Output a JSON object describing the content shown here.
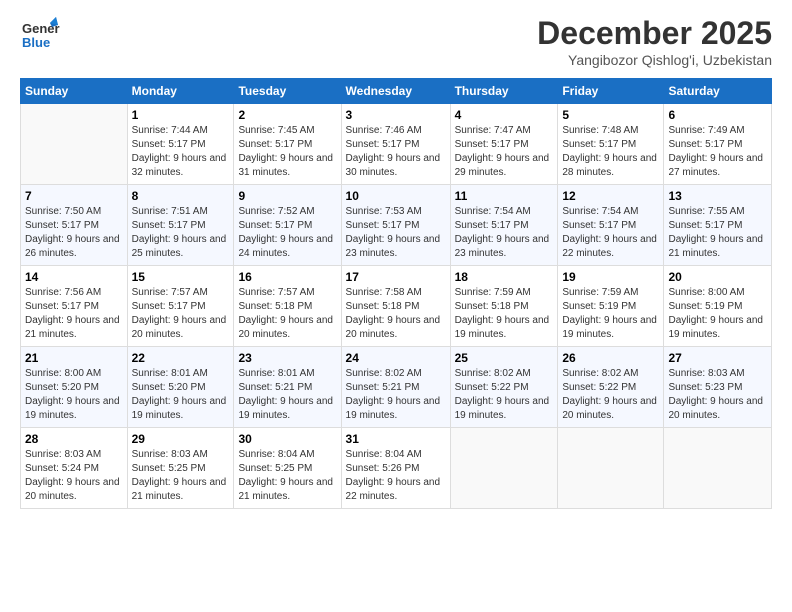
{
  "header": {
    "logo_general": "General",
    "logo_blue": "Blue",
    "month": "December 2025",
    "location": "Yangibozor Qishlog'i, Uzbekistan"
  },
  "days_of_week": [
    "Sunday",
    "Monday",
    "Tuesday",
    "Wednesday",
    "Thursday",
    "Friday",
    "Saturday"
  ],
  "weeks": [
    [
      {
        "day": "",
        "sunrise": "",
        "sunset": "",
        "daylight": ""
      },
      {
        "day": "1",
        "sunrise": "Sunrise: 7:44 AM",
        "sunset": "Sunset: 5:17 PM",
        "daylight": "Daylight: 9 hours and 32 minutes."
      },
      {
        "day": "2",
        "sunrise": "Sunrise: 7:45 AM",
        "sunset": "Sunset: 5:17 PM",
        "daylight": "Daylight: 9 hours and 31 minutes."
      },
      {
        "day": "3",
        "sunrise": "Sunrise: 7:46 AM",
        "sunset": "Sunset: 5:17 PM",
        "daylight": "Daylight: 9 hours and 30 minutes."
      },
      {
        "day": "4",
        "sunrise": "Sunrise: 7:47 AM",
        "sunset": "Sunset: 5:17 PM",
        "daylight": "Daylight: 9 hours and 29 minutes."
      },
      {
        "day": "5",
        "sunrise": "Sunrise: 7:48 AM",
        "sunset": "Sunset: 5:17 PM",
        "daylight": "Daylight: 9 hours and 28 minutes."
      },
      {
        "day": "6",
        "sunrise": "Sunrise: 7:49 AM",
        "sunset": "Sunset: 5:17 PM",
        "daylight": "Daylight: 9 hours and 27 minutes."
      }
    ],
    [
      {
        "day": "7",
        "sunrise": "Sunrise: 7:50 AM",
        "sunset": "Sunset: 5:17 PM",
        "daylight": "Daylight: 9 hours and 26 minutes."
      },
      {
        "day": "8",
        "sunrise": "Sunrise: 7:51 AM",
        "sunset": "Sunset: 5:17 PM",
        "daylight": "Daylight: 9 hours and 25 minutes."
      },
      {
        "day": "9",
        "sunrise": "Sunrise: 7:52 AM",
        "sunset": "Sunset: 5:17 PM",
        "daylight": "Daylight: 9 hours and 24 minutes."
      },
      {
        "day": "10",
        "sunrise": "Sunrise: 7:53 AM",
        "sunset": "Sunset: 5:17 PM",
        "daylight": "Daylight: 9 hours and 23 minutes."
      },
      {
        "day": "11",
        "sunrise": "Sunrise: 7:54 AM",
        "sunset": "Sunset: 5:17 PM",
        "daylight": "Daylight: 9 hours and 23 minutes."
      },
      {
        "day": "12",
        "sunrise": "Sunrise: 7:54 AM",
        "sunset": "Sunset: 5:17 PM",
        "daylight": "Daylight: 9 hours and 22 minutes."
      },
      {
        "day": "13",
        "sunrise": "Sunrise: 7:55 AM",
        "sunset": "Sunset: 5:17 PM",
        "daylight": "Daylight: 9 hours and 21 minutes."
      }
    ],
    [
      {
        "day": "14",
        "sunrise": "Sunrise: 7:56 AM",
        "sunset": "Sunset: 5:17 PM",
        "daylight": "Daylight: 9 hours and 21 minutes."
      },
      {
        "day": "15",
        "sunrise": "Sunrise: 7:57 AM",
        "sunset": "Sunset: 5:17 PM",
        "daylight": "Daylight: 9 hours and 20 minutes."
      },
      {
        "day": "16",
        "sunrise": "Sunrise: 7:57 AM",
        "sunset": "Sunset: 5:18 PM",
        "daylight": "Daylight: 9 hours and 20 minutes."
      },
      {
        "day": "17",
        "sunrise": "Sunrise: 7:58 AM",
        "sunset": "Sunset: 5:18 PM",
        "daylight": "Daylight: 9 hours and 20 minutes."
      },
      {
        "day": "18",
        "sunrise": "Sunrise: 7:59 AM",
        "sunset": "Sunset: 5:18 PM",
        "daylight": "Daylight: 9 hours and 19 minutes."
      },
      {
        "day": "19",
        "sunrise": "Sunrise: 7:59 AM",
        "sunset": "Sunset: 5:19 PM",
        "daylight": "Daylight: 9 hours and 19 minutes."
      },
      {
        "day": "20",
        "sunrise": "Sunrise: 8:00 AM",
        "sunset": "Sunset: 5:19 PM",
        "daylight": "Daylight: 9 hours and 19 minutes."
      }
    ],
    [
      {
        "day": "21",
        "sunrise": "Sunrise: 8:00 AM",
        "sunset": "Sunset: 5:20 PM",
        "daylight": "Daylight: 9 hours and 19 minutes."
      },
      {
        "day": "22",
        "sunrise": "Sunrise: 8:01 AM",
        "sunset": "Sunset: 5:20 PM",
        "daylight": "Daylight: 9 hours and 19 minutes."
      },
      {
        "day": "23",
        "sunrise": "Sunrise: 8:01 AM",
        "sunset": "Sunset: 5:21 PM",
        "daylight": "Daylight: 9 hours and 19 minutes."
      },
      {
        "day": "24",
        "sunrise": "Sunrise: 8:02 AM",
        "sunset": "Sunset: 5:21 PM",
        "daylight": "Daylight: 9 hours and 19 minutes."
      },
      {
        "day": "25",
        "sunrise": "Sunrise: 8:02 AM",
        "sunset": "Sunset: 5:22 PM",
        "daylight": "Daylight: 9 hours and 19 minutes."
      },
      {
        "day": "26",
        "sunrise": "Sunrise: 8:02 AM",
        "sunset": "Sunset: 5:22 PM",
        "daylight": "Daylight: 9 hours and 20 minutes."
      },
      {
        "day": "27",
        "sunrise": "Sunrise: 8:03 AM",
        "sunset": "Sunset: 5:23 PM",
        "daylight": "Daylight: 9 hours and 20 minutes."
      }
    ],
    [
      {
        "day": "28",
        "sunrise": "Sunrise: 8:03 AM",
        "sunset": "Sunset: 5:24 PM",
        "daylight": "Daylight: 9 hours and 20 minutes."
      },
      {
        "day": "29",
        "sunrise": "Sunrise: 8:03 AM",
        "sunset": "Sunset: 5:25 PM",
        "daylight": "Daylight: 9 hours and 21 minutes."
      },
      {
        "day": "30",
        "sunrise": "Sunrise: 8:04 AM",
        "sunset": "Sunset: 5:25 PM",
        "daylight": "Daylight: 9 hours and 21 minutes."
      },
      {
        "day": "31",
        "sunrise": "Sunrise: 8:04 AM",
        "sunset": "Sunset: 5:26 PM",
        "daylight": "Daylight: 9 hours and 22 minutes."
      },
      {
        "day": "",
        "sunrise": "",
        "sunset": "",
        "daylight": ""
      },
      {
        "day": "",
        "sunrise": "",
        "sunset": "",
        "daylight": ""
      },
      {
        "day": "",
        "sunrise": "",
        "sunset": "",
        "daylight": ""
      }
    ]
  ]
}
